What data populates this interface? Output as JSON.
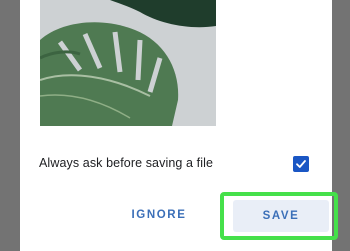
{
  "dialog": {
    "preview_image": "monstera-leaf-photo",
    "ask_before_saving": {
      "label": "Always ask before saving a file",
      "checked": true
    },
    "buttons": {
      "ignore_label": "IGNORE",
      "save_label": "SAVE"
    }
  },
  "colors": {
    "accent": "#1a56c4",
    "button_text": "#3b6fb8",
    "highlight": "#45e04a",
    "scrim": "#737373"
  }
}
